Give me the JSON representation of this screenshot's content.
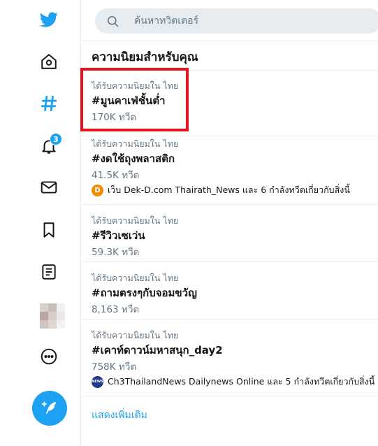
{
  "search": {
    "placeholder": "ค้นหาทวิตเตอร์"
  },
  "section_title": "ความนิยมสำหรับคุณ",
  "nav": {
    "items": [
      "logo",
      "home",
      "explore",
      "notifications",
      "messages",
      "bookmarks",
      "lists",
      "profile",
      "more"
    ],
    "notification_count": "3"
  },
  "trends": [
    {
      "context": "ได้รับความนิยมใน ไทย",
      "name": "#มูนคาเฟ่ชั้นต่ำ",
      "count": "170K ทวีต"
    },
    {
      "context": "ได้รับความนิยมใน ไทย",
      "name": "#งดใช้ถุงพลาสติก",
      "count": "41.5K ทวีต",
      "related": "เว็บ Dek-D.com Thairath_News และ 6 กำลังทวีตเกี่ยวกับสิ่งนี้",
      "related_icon": "D",
      "related_icon_color": "#f28c00"
    },
    {
      "context": "ได้รับความนิยมใน ไทย",
      "name": "#รีวิวเซเว่น",
      "count": "59.3K ทวีต"
    },
    {
      "context": "ได้รับความนิยมใน ไทย",
      "name": "#ถามตรงๆกับจอมขวัญ",
      "count": "8,163 ทวีต"
    },
    {
      "context": "ได้รับความนิยมใน ไทย",
      "name": "#เคาท์ดาวน์มหาสนุก_day2",
      "count": "758K ทวีต",
      "related": "Ch3ThailandNews Dailynews Online และ 5 กำลังทวีตเกี่ยวกับสิ่งนี้",
      "related_icon": "NEWS",
      "related_icon_color": "#1f3a8a"
    }
  ],
  "show_more": "แสดงเพิ่มเติม",
  "colors": {
    "accent": "#1da1f2",
    "highlight": "#e8121e"
  }
}
